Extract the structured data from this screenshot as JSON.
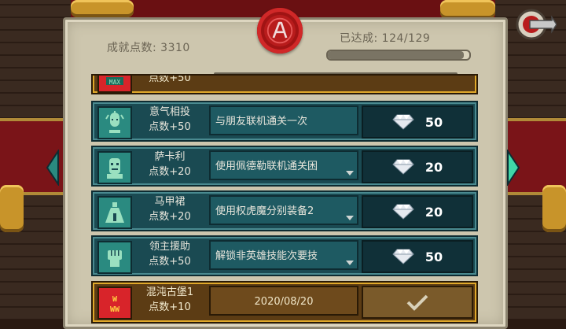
{
  "header": {
    "score_label": "成就点数: 3310",
    "achieved_label": "已达成: 124/129",
    "progress_fraction": 0.961
  },
  "achievements": [
    {
      "name": "意气相投",
      "points": "点数+50",
      "description": "与朋友联机通关一次",
      "reward": "50",
      "icon": "friends-icon",
      "has_dropdown": false
    },
    {
      "name": "萨卡利",
      "points": "点数+20",
      "description": "使用佩德勒联机通关困",
      "reward": "20",
      "icon": "face-mask-icon",
      "has_dropdown": true
    },
    {
      "name": "马甲裙",
      "points": "点数+20",
      "description": "使用权虎魔分别装备2",
      "reward": "20",
      "icon": "dress-icon",
      "has_dropdown": true
    },
    {
      "name": "领主援助",
      "points": "点数+50",
      "description": "解锁非英雄技能次要技",
      "reward": "50",
      "icon": "fist-icon",
      "has_dropdown": true
    },
    {
      "name": "混沌古堡1",
      "points": "点数+10",
      "description": "2020/08/20",
      "reward": "",
      "icon": "castle-icon",
      "completed": true
    }
  ],
  "partial_top_row": {
    "points": "点数+50",
    "icon": "max-icon"
  },
  "colors": {
    "parchment": "#cdc6ae",
    "row_teal": "#1a4a52",
    "row_gold": "#e0a82a",
    "seal_red": "#b81c1c"
  }
}
